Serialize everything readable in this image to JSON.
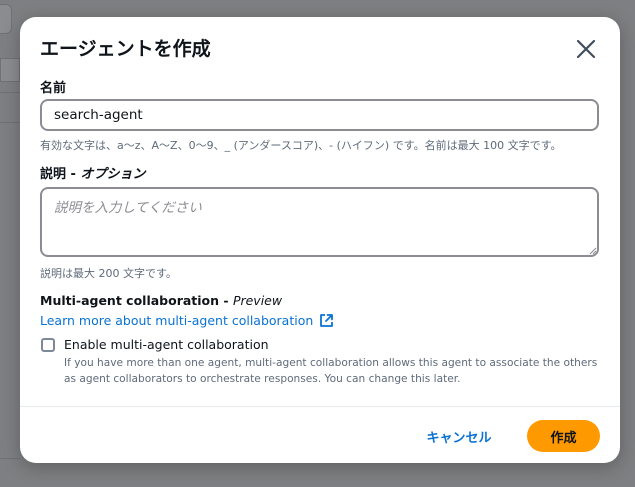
{
  "modal": {
    "title": "エージェントを作成",
    "name_label": "名前",
    "name_value": "search-agent",
    "name_hint": "有効な文字は、a～z、A～Z、0～9、_ (アンダースコア)、- (ハイフン) です。名前は最大 100 文字です。",
    "desc_label": "説明 - ",
    "desc_label_optional": "オプション",
    "desc_placeholder": "説明を入力してください",
    "desc_hint": "説明は最大 200 文字です。",
    "collab_title": "Multi-agent collaboration - ",
    "collab_preview": "Preview",
    "collab_link": "Learn more about multi-agent collaboration",
    "checkbox_label": "Enable multi-agent collaboration",
    "checkbox_checked": false,
    "checkbox_desc": "If you have more than one agent, multi-agent collaboration allows this agent to associate the others as agent collaborators to orchestrate responses. You can change this later.",
    "cancel_label": "キャンセル",
    "create_label": "作成"
  },
  "colors": {
    "accent": "#ff9900",
    "link": "#0972d3",
    "overlay": "#7d7f82"
  },
  "icons": [
    "close-icon",
    "external-link-icon",
    "resize-grip-icon"
  ]
}
